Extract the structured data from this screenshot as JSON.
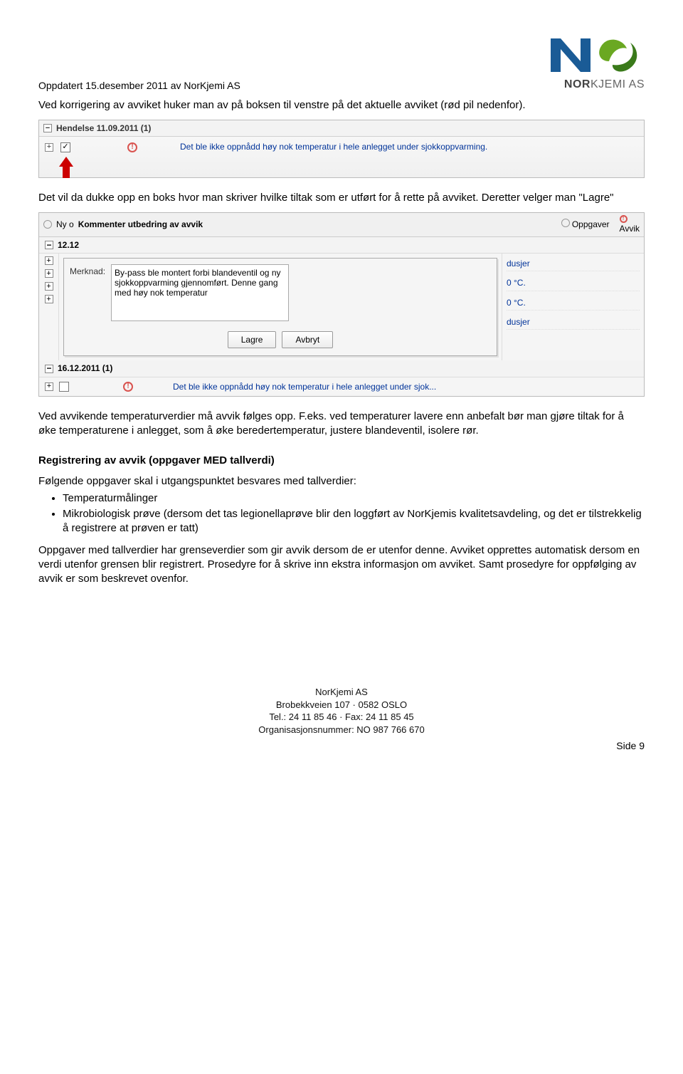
{
  "header": {
    "updated": "Oppdatert 15.desember 2011 av NorKjemi AS",
    "logo_name": "NOR",
    "logo_name2": "KJEMI AS"
  },
  "para1": "Ved korrigering av avviket huker man av på boksen til venstre på det aktuelle avviket (rød pil nedenfor).",
  "ui1": {
    "group_title": "Hendelse 11.09.2011 (1)",
    "row_message": "Det ble ikke oppnådd høy nok temperatur i hele anlegget under sjokkoppvarming."
  },
  "para2": "Det vil da dukke opp en boks hvor man skriver hvilke tiltak som er utført for å rette på avviket. Deretter velger man \"Lagre\"",
  "ui2": {
    "toolbar_left": "Ny o",
    "toolbar_b": "Kommenter utbedring av avvik",
    "toolbar_opp": "Oppgaver",
    "toolbar_avv": "Avvik",
    "date1": "12.12",
    "dialog_title": "Kommenter utbedring av avvik",
    "merknad_label": "Merknad:",
    "merknad_text": "By-pass ble montert forbi blandeventil og ny sjokkoppvarming gjennomført. Denne gang med høy nok temperatur",
    "btn_save": "Lagre",
    "btn_cancel": "Avbryt",
    "right_rows": [
      "dusjer",
      "0 °C.",
      "0 °C.",
      "dusjer"
    ],
    "group2_title": "16.12.2011 (1)",
    "row2_message": "Det ble ikke oppnådd høy nok temperatur i hele anlegget under sjok..."
  },
  "para3": "Ved avvikende temperaturverdier må avvik følges opp. F.eks. ved temperaturer lavere enn anbefalt bør man gjøre tiltak for å øke temperaturene i anlegget, som å øke beredertemperatur, justere blandeventil, isolere rør.",
  "section_title": "Registrering av avvik (oppgaver MED tallverdi)",
  "para4": "Følgende oppgaver skal i utgangspunktet besvares med tallverdier:",
  "bullets": [
    "Temperaturmålinger",
    "Mikrobiologisk prøve (dersom det tas legionellaprøve blir den loggført av NorKjemis kvalitetsavdeling, og det er tilstrekkelig å registrere at prøven er tatt)"
  ],
  "para5": "Oppgaver med tallverdier har grenseverdier som gir avvik dersom de er utenfor denne. Avviket opprettes automatisk dersom en verdi utenfor grensen blir registrert. Prosedyre for å skrive inn ekstra informasjon om avviket. Samt prosedyre for oppfølging av avvik er som beskrevet ovenfor.",
  "footer": {
    "l1": "NorKjemi AS",
    "l2": "Brobekkveien 107 · 0582 OSLO",
    "l3": "Tel.: 24 11 85 46 · Fax: 24 11 85 45",
    "l4": "Organisasjonsnummer: NO 987 766 670"
  },
  "page": "Side 9"
}
